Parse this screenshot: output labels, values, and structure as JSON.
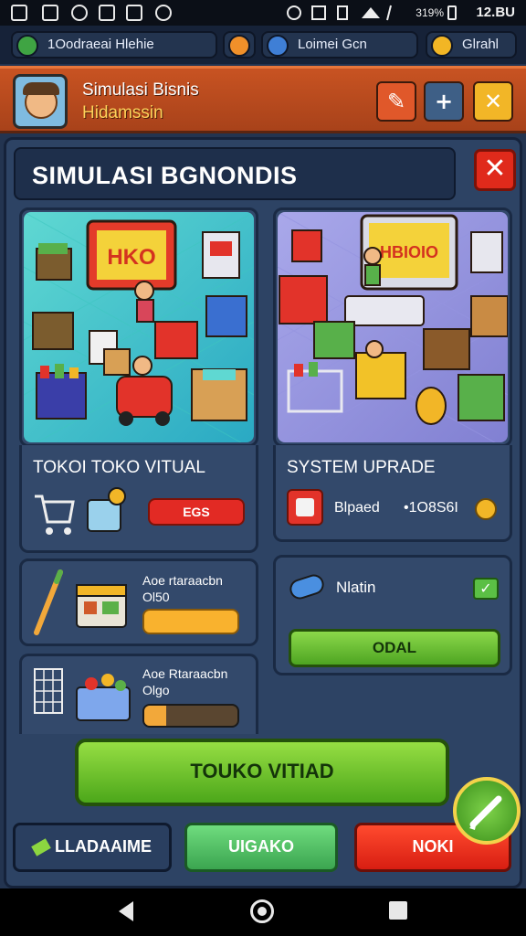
{
  "status_bar": {
    "battery_pct": "319%",
    "time": "12.BU"
  },
  "resources": [
    {
      "label": "1Oodraeai Hlehie",
      "icon": "green-gem-icon",
      "color": "#3fa443"
    },
    {
      "label": "",
      "icon": "orange-coin-icon",
      "color": "#f0902a"
    },
    {
      "label": "Loimei Gcn",
      "icon": "blue-gem-icon",
      "color": "#3f7fd6"
    },
    {
      "label": "Glrahl",
      "icon": "gold-coin-icon",
      "color": "#f2b625"
    }
  ],
  "header": {
    "title": "Simulasi Bisnis",
    "subtitle": "Hidamssin",
    "buttons": [
      {
        "name": "tools-button",
        "glyph": "✎",
        "color": "#e0582a"
      },
      {
        "name": "add-button",
        "glyph": "+",
        "color": "#3e5f86"
      },
      {
        "name": "close-header-button",
        "glyph": "✕",
        "color": "#f2b627"
      }
    ]
  },
  "panel": {
    "title": "SIMULASI BGNONDIS",
    "close_glyph": "✕"
  },
  "left_card": {
    "sign_text": "HKO",
    "title": "TOKOI TOKO VITUAL",
    "button_label": "EGS",
    "item1_text": "Aoe rtaraacbn",
    "item1_value": "Ol50",
    "item2_text": "Aoe Rtaraacbn",
    "item2_value": "Olgo"
  },
  "right_card": {
    "sign_text": "HBIOIO",
    "title": "SYSTEM UPRADE",
    "cost_label": "Blpaed",
    "cost_value": "•1O8S6I",
    "status_label": "Nlatin",
    "button_label": "ODAL"
  },
  "main_button": "TOUKO VITIAD",
  "bottom_buttons": {
    "left": "LLADAAIME",
    "middle": "UIGAKO",
    "right": "NOKI"
  },
  "colors": {
    "accent_red": "#e02a1b",
    "accent_green": "#4ca71a",
    "panel_bg": "#2d4364"
  }
}
